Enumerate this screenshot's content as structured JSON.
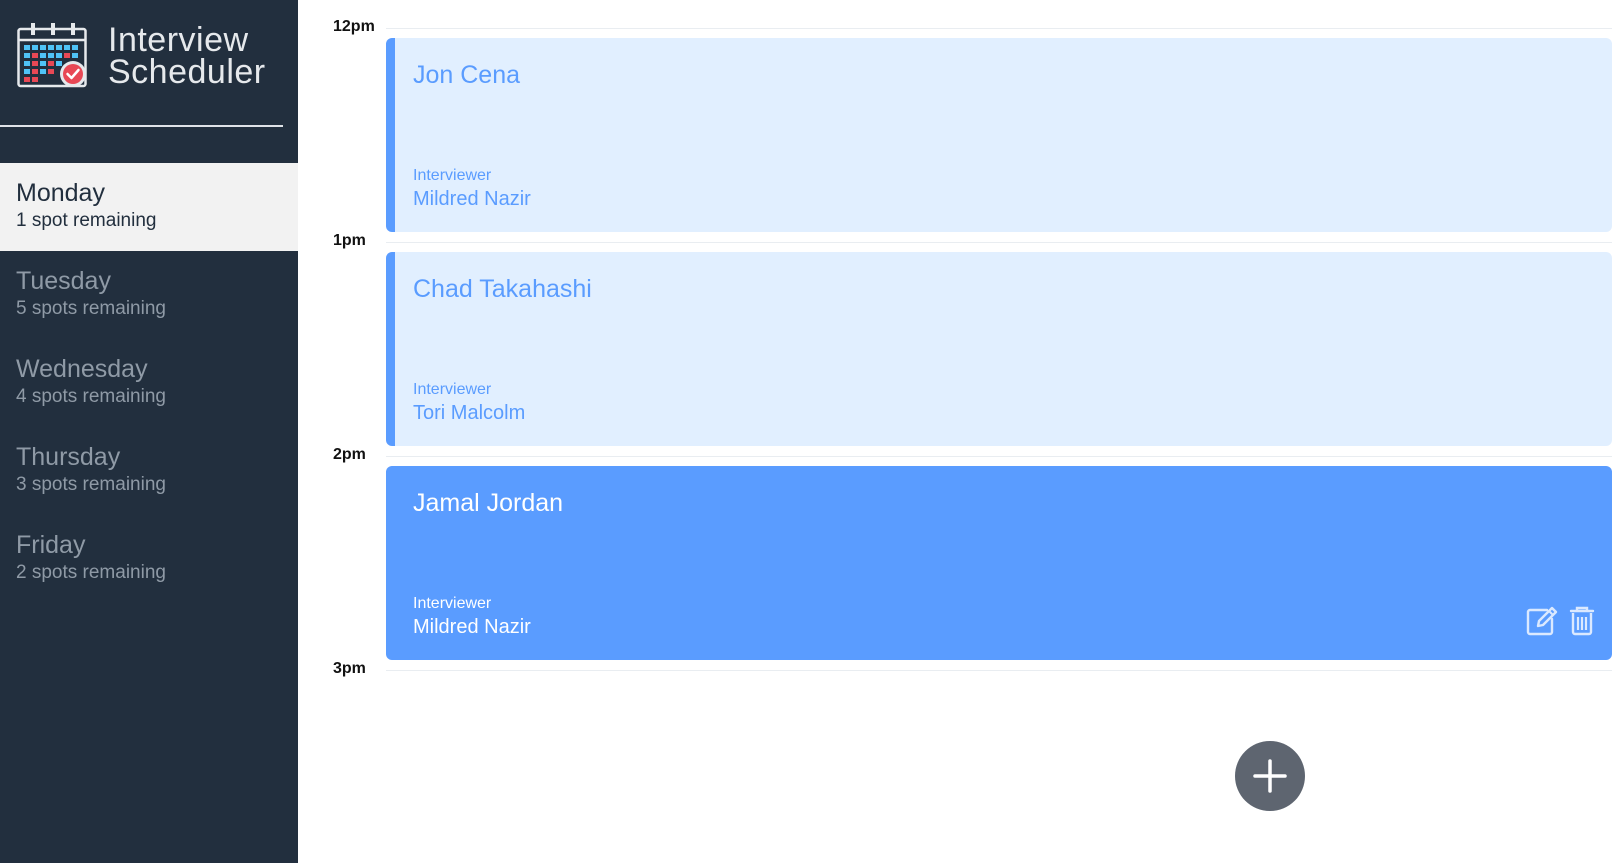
{
  "app": {
    "title_line1": "Interview",
    "title_line2": "Scheduler"
  },
  "days": [
    {
      "name": "Monday",
      "spots": "1 spot remaining",
      "selected": true
    },
    {
      "name": "Tuesday",
      "spots": "5 spots remaining",
      "selected": false
    },
    {
      "name": "Wednesday",
      "spots": "4 spots remaining",
      "selected": false
    },
    {
      "name": "Thursday",
      "spots": "3 spots remaining",
      "selected": false
    },
    {
      "name": "Friday",
      "spots": "2 spots remaining",
      "selected": false
    }
  ],
  "hours": [
    "12pm",
    "1pm",
    "2pm",
    "3pm"
  ],
  "appointments": [
    {
      "student": "Jon Cena",
      "interviewer_label": "Interviewer",
      "interviewer": "Mildred Nazir"
    },
    {
      "student": "Chad Takahashi",
      "interviewer_label": "Interviewer",
      "interviewer": "Tori Malcolm"
    },
    {
      "student": "Jamal Jordan",
      "interviewer_label": "Interviewer",
      "interviewer": "Mildred Nazir"
    }
  ],
  "icons": {
    "logo": "calendar-check-icon",
    "edit": "edit-icon",
    "delete": "trash-icon",
    "add": "plus-icon"
  },
  "colors": {
    "sidebar": "#222f3e",
    "accent": "#5a9cff",
    "appointment_bg": "#e1efff",
    "add_button": "#5e6570"
  }
}
